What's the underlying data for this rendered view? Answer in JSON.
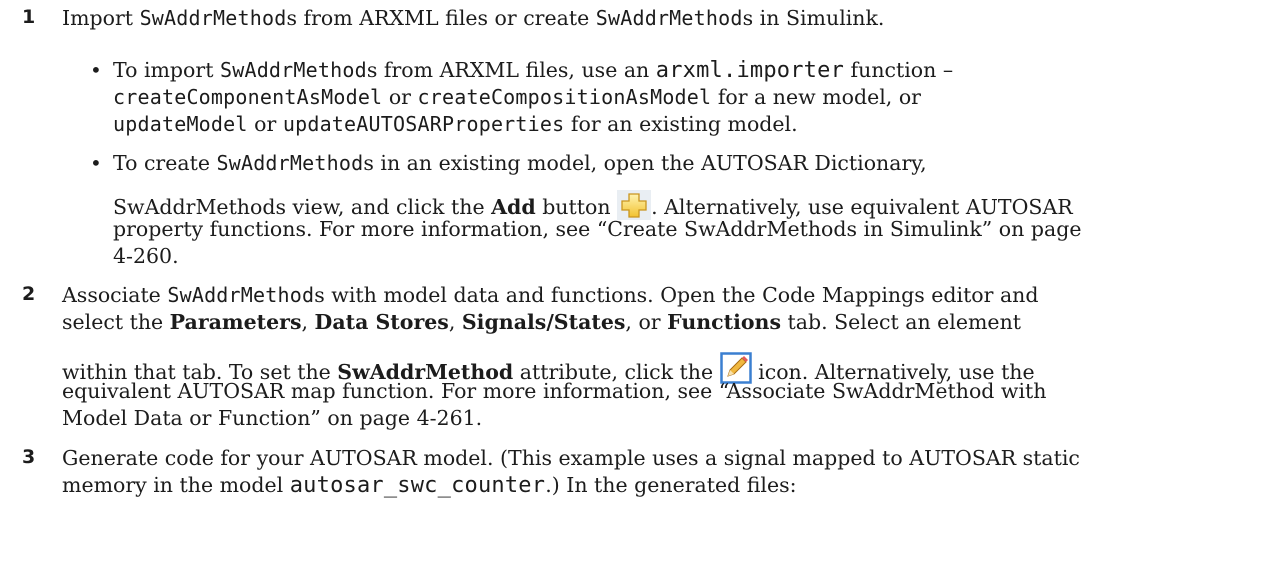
{
  "steps": [
    {
      "number": "1",
      "lines": [
        {
          "t1": "Import ",
          "c1": "SwAddrMethod",
          "t2": "s from ARXML files or create ",
          "c2": "SwAddrMethod",
          "t3": "s in Simulink."
        }
      ],
      "bullets": [
        {
          "line1": {
            "t1": "To import ",
            "c1": "SwAddrMethod",
            "t2": "s from ARXML files, use an ",
            "c2": "arxml.importer",
            "t3": " function –"
          },
          "line2": {
            "c1": "createComponentAsModel",
            "t1": " or ",
            "c2": "createCompositionAsModel",
            "t2": " for a new model, or"
          },
          "line3": {
            "c1": "updateModel",
            "t1": " or ",
            "c2": "updateAUTOSARProperties",
            "t2": " for an existing model."
          }
        },
        {
          "line1": {
            "t1": "To create ",
            "c1": "SwAddrMethod",
            "t2": "s in an existing model, open the AUTOSAR Dictionary,"
          },
          "line2": {
            "t1": "SwAddrMethods view, and click the ",
            "b1": "Add",
            "t2": " button ",
            "t3": ". Alternatively, use equivalent AUTOSAR"
          },
          "line3": {
            "t1": "property functions. For more information, see “Create SwAddrMethods in Simulink” on page"
          },
          "line4": {
            "t1": "4-260."
          }
        }
      ]
    },
    {
      "number": "2",
      "line1": {
        "t1": "Associate ",
        "c1": "SwAddrMethod",
        "t2": "s with model data and functions. Open the Code Mappings editor and"
      },
      "line2": {
        "t1": "select the ",
        "b1": "Parameters",
        "t2": ", ",
        "b2": "Data Stores",
        "t3": ", ",
        "b3": "Signals/States",
        "t4": ", or ",
        "b4": "Functions",
        "t5": " tab. Select an element"
      },
      "line3": {
        "t1": "within that tab. To set the ",
        "b1": "SwAddrMethod",
        "t2": " attribute, click the ",
        "t3": " icon. Alternatively, use the"
      },
      "line4": {
        "t1": "equivalent AUTOSAR map function. For more information, see “Associate SwAddrMethod with"
      },
      "line5": {
        "t1": "Model Data or Function” on page 4-261."
      }
    },
    {
      "number": "3",
      "line1": {
        "t1": "Generate code for your AUTOSAR model. (This example uses a signal mapped to AUTOSAR static"
      },
      "line2": {
        "t1": "memory in the model ",
        "c1": "autosar_swc_counter",
        "t2": ".) In the generated files:"
      }
    }
  ],
  "bullet_char": "•",
  "icons": {
    "add": "add-plus-icon",
    "edit": "pencil-edit-icon"
  },
  "colors": {
    "text": "#1c1c1c",
    "add_icon_fill": "#f6cf4a",
    "edit_icon_frame": "#3a7fd0"
  }
}
